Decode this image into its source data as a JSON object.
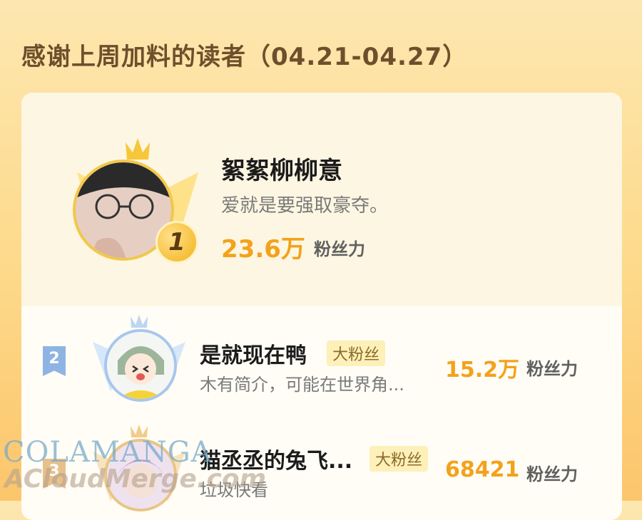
{
  "header": {
    "title": "感谢上周加料的读者（04.21-04.27）"
  },
  "fans_unit": "粉丝力",
  "readers": [
    {
      "rank": "1",
      "name": "絮絮柳柳意",
      "bio": "爱就是要强取豪夺。",
      "fans": "23.6万"
    },
    {
      "rank": "2",
      "name": "是就现在鸭",
      "badge": "大粉丝",
      "bio": "木有简介，可能在世界角...",
      "fans": "15.2万"
    },
    {
      "rank": "3",
      "name": "猫丞丞的兔飞...",
      "badge": "大粉丝",
      "bio": "垃圾快看",
      "fans": "68421"
    }
  ],
  "watermark": {
    "line1": "COLAMANGA",
    "line2": "ACloudMerge.com"
  },
  "colors": {
    "accent": "#f3a21b",
    "title": "#6e4f2c",
    "background": "#fdd98a"
  }
}
